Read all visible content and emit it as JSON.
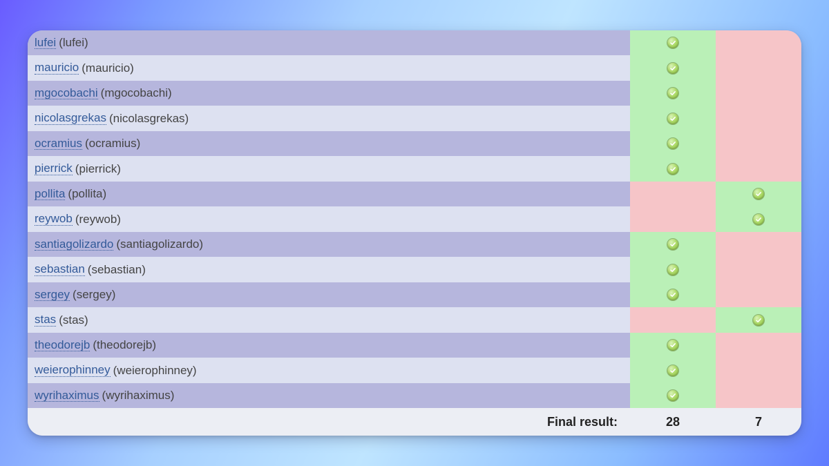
{
  "final_label": "Final result:",
  "final_yes": "28",
  "final_no": "7",
  "rows": [
    {
      "user": "lufei",
      "handle": "(lufei)",
      "vote": "yes"
    },
    {
      "user": "mauricio",
      "handle": "(mauricio)",
      "vote": "yes"
    },
    {
      "user": "mgocobachi",
      "handle": "(mgocobachi)",
      "vote": "yes"
    },
    {
      "user": "nicolasgrekas",
      "handle": "(nicolasgrekas)",
      "vote": "yes"
    },
    {
      "user": "ocramius",
      "handle": "(ocramius)",
      "vote": "yes"
    },
    {
      "user": "pierrick",
      "handle": "(pierrick)",
      "vote": "yes"
    },
    {
      "user": "pollita",
      "handle": "(pollita)",
      "vote": "no"
    },
    {
      "user": "reywob",
      "handle": "(reywob)",
      "vote": "no"
    },
    {
      "user": "santiagolizardo",
      "handle": "(santiagolizardo)",
      "vote": "yes"
    },
    {
      "user": "sebastian",
      "handle": "(sebastian)",
      "vote": "yes"
    },
    {
      "user": "sergey",
      "handle": "(sergey)",
      "vote": "yes"
    },
    {
      "user": "stas",
      "handle": "(stas)",
      "vote": "no"
    },
    {
      "user": "theodorejb",
      "handle": "(theodorejb)",
      "vote": "yes"
    },
    {
      "user": "weierophinney",
      "handle": "(weierophinney)",
      "vote": "yes"
    },
    {
      "user": "wyrihaximus",
      "handle": "(wyrihaximus)",
      "vote": "yes"
    }
  ]
}
